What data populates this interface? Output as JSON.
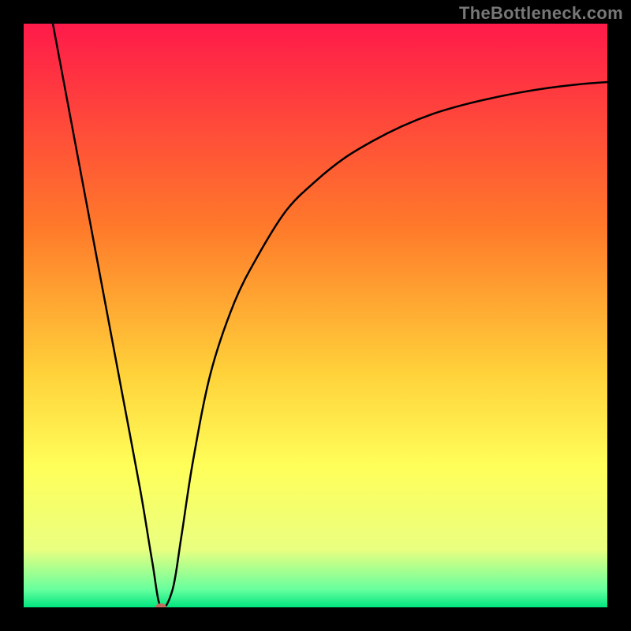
{
  "watermark": "TheBottleneck.com",
  "chart_data": {
    "type": "line",
    "title": "",
    "xlabel": "",
    "ylabel": "",
    "xlim": [
      0,
      100
    ],
    "ylim": [
      0,
      100
    ],
    "gradient_stops": [
      {
        "offset": 0,
        "color": "#ff1a4a"
      },
      {
        "offset": 35,
        "color": "#ff7a2a"
      },
      {
        "offset": 60,
        "color": "#ffd23a"
      },
      {
        "offset": 76,
        "color": "#ffff5a"
      },
      {
        "offset": 90,
        "color": "#eaff80"
      },
      {
        "offset": 97,
        "color": "#66ff9e"
      },
      {
        "offset": 100,
        "color": "#00e57f"
      }
    ],
    "series": [
      {
        "name": "bottleneck-curve",
        "x": [
          5,
          8,
          11,
          14,
          17,
          20,
          22,
          23.5,
          25.5,
          27,
          29,
          32,
          36,
          40,
          45,
          50,
          55,
          60,
          65,
          70,
          75,
          80,
          85,
          90,
          95,
          100
        ],
        "y": [
          100,
          84,
          68,
          52,
          36,
          20,
          8,
          0,
          3,
          12,
          25,
          40,
          52,
          60,
          68,
          73,
          77,
          80,
          82.5,
          84.5,
          86,
          87.2,
          88.2,
          89,
          89.6,
          90
        ]
      }
    ],
    "marker": {
      "x": 23.5,
      "y": 0
    }
  }
}
